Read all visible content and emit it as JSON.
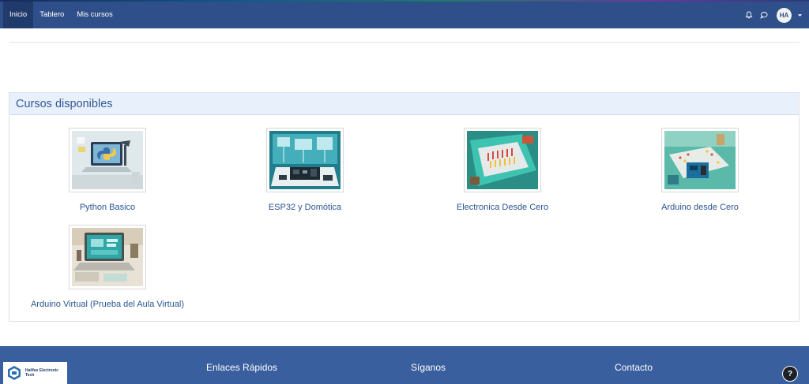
{
  "nav": {
    "items": [
      {
        "label": "Inicio"
      },
      {
        "label": "Tablero"
      },
      {
        "label": "Mis cursos"
      }
    ],
    "notifications_icon": "bell-icon",
    "messages_icon": "chat-bubble-icon",
    "user_initials": "HA"
  },
  "courses_section": {
    "title": "Cursos disponibles",
    "courses": [
      {
        "name": "Python Basico"
      },
      {
        "name": "ESP32 y Domótica"
      },
      {
        "name": "Electronica Desde Cero"
      },
      {
        "name": "Arduino desde Cero"
      },
      {
        "name": "Arduino Virtual (Prueba del Aula Virtual)"
      }
    ]
  },
  "footer": {
    "logo_text": "Halifax Electronic Tech",
    "columns": [
      {
        "heading": "Enlaces Rápidos"
      },
      {
        "heading": "Síganos"
      },
      {
        "heading": "Contacto"
      }
    ],
    "help_label": "?"
  },
  "colors": {
    "nav_bg": "#2f4f8a",
    "panel_header_bg": "#e8f0fb",
    "link": "#2a5592",
    "footer_bg": "#3a5f9e"
  }
}
